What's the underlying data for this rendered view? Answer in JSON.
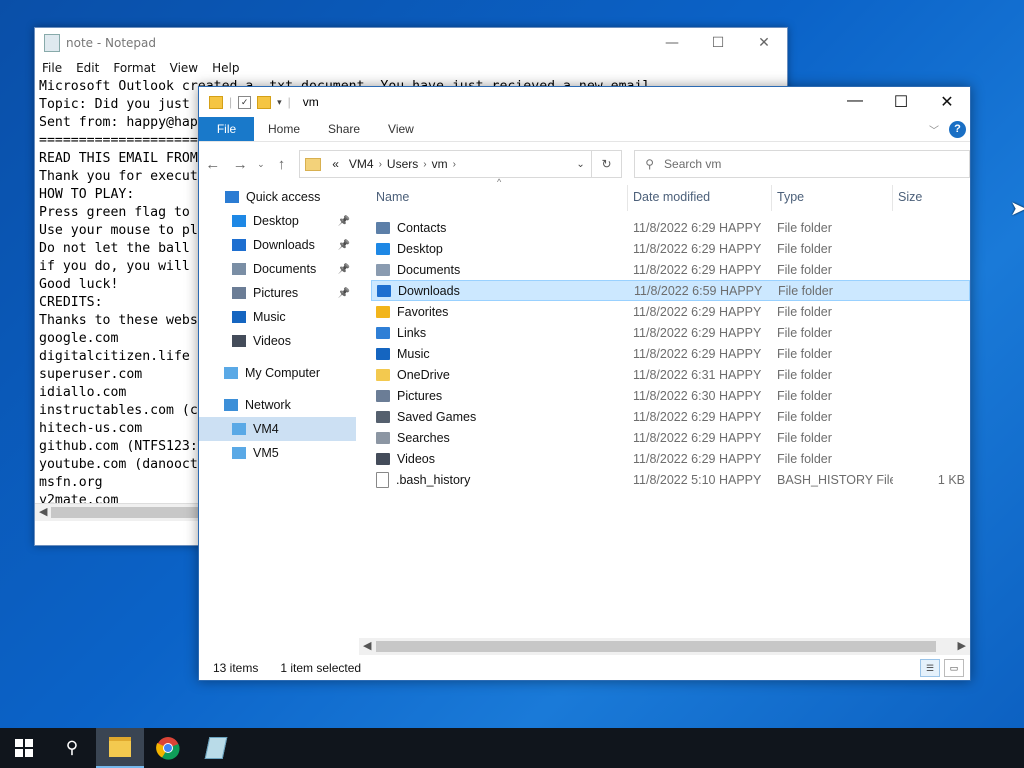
{
  "notepad": {
    "title": "note - Notepad",
    "menu": [
      "File",
      "Edit",
      "Format",
      "View",
      "Help"
    ],
    "lines": [
      "Microsoft Outlook created a .txt document. You have just recieved a new email",
      "Topic: Did you just",
      "Sent from: happy@hap",
      "================================",
      "READ THIS EMAIL FROM",
      "Thank you for execut",
      "HOW TO PLAY:",
      "Press green flag to",
      "Use your mouse to pl",
      "Do not let the ball",
      "if you do, you will",
      "Good luck!",
      "CREDITS:",
      "Thanks to these webs",
      "google.com",
      "digitalcitizen.life",
      "superuser.com",
      "idiallo.com",
      "instructables.com (c",
      "hitech-us.com",
      "github.com (NTFS123:",
      "youtube.com (danooct",
      "msfn.org",
      "y2mate.com"
    ]
  },
  "explorer": {
    "title": "vm",
    "ribbon_tabs": [
      "File",
      "Home",
      "Share",
      "View"
    ],
    "address": [
      "VM4",
      "Users",
      "vm"
    ],
    "address_prefix": "«",
    "search_placeholder": "Search vm",
    "nav": {
      "quick_access": "Quick access",
      "quick_items": [
        {
          "label": "Desktop",
          "icon": "desktop-icon",
          "color": "#1e88e5"
        },
        {
          "label": "Downloads",
          "icon": "download-icon",
          "color": "#1e6fd0"
        },
        {
          "label": "Documents",
          "icon": "documents-icon",
          "color": "#7a8ea5"
        },
        {
          "label": "Pictures",
          "icon": "pictures-icon",
          "color": "#6b7d96"
        },
        {
          "label": "Music",
          "icon": "music-icon",
          "color": "#1565c0"
        },
        {
          "label": "Videos",
          "icon": "videos-icon",
          "color": "#444c5a"
        }
      ],
      "my_computer": "My Computer",
      "network": "Network",
      "network_items": [
        "VM4",
        "VM5"
      ]
    },
    "columns": [
      "Name",
      "Date modified",
      "Type",
      "Size"
    ],
    "files": [
      {
        "name": "Contacts",
        "date": "11/8/2022 6:29 HAPPY",
        "type": "File folder",
        "size": "",
        "icon": "contacts-icon",
        "color": "#5c7fa8"
      },
      {
        "name": "Desktop",
        "date": "11/8/2022 6:29 HAPPY",
        "type": "File folder",
        "size": "",
        "icon": "desktop-icon",
        "color": "#1e88e5"
      },
      {
        "name": "Documents",
        "date": "11/8/2022 6:29 HAPPY",
        "type": "File folder",
        "size": "",
        "icon": "documents-icon",
        "color": "#8a9bb0"
      },
      {
        "name": "Downloads",
        "date": "11/8/2022 6:59 HAPPY",
        "type": "File folder",
        "size": "",
        "icon": "download-icon",
        "color": "#1e6fd0"
      },
      {
        "name": "Favorites",
        "date": "11/8/2022 6:29 HAPPY",
        "type": "File folder",
        "size": "",
        "icon": "star-icon",
        "color": "#f2b51b"
      },
      {
        "name": "Links",
        "date": "11/8/2022 6:29 HAPPY",
        "type": "File folder",
        "size": "",
        "icon": "links-icon",
        "color": "#2f7fd6"
      },
      {
        "name": "Music",
        "date": "11/8/2022 6:29 HAPPY",
        "type": "File folder",
        "size": "",
        "icon": "music-icon",
        "color": "#1565c0"
      },
      {
        "name": "OneDrive",
        "date": "11/8/2022 6:31 HAPPY",
        "type": "File folder",
        "size": "",
        "icon": "folder-icon",
        "color": "#f3c94f"
      },
      {
        "name": "Pictures",
        "date": "11/8/2022 6:30 HAPPY",
        "type": "File folder",
        "size": "",
        "icon": "pictures-icon",
        "color": "#6b7d96"
      },
      {
        "name": "Saved Games",
        "date": "11/8/2022 6:29 HAPPY",
        "type": "File folder",
        "size": "",
        "icon": "saved-games-icon",
        "color": "#55606e"
      },
      {
        "name": "Searches",
        "date": "11/8/2022 6:29 HAPPY",
        "type": "File folder",
        "size": "",
        "icon": "search-icon",
        "color": "#8c96a3"
      },
      {
        "name": "Videos",
        "date": "11/8/2022 6:29 HAPPY",
        "type": "File folder",
        "size": "",
        "icon": "videos-icon",
        "color": "#444c5a"
      },
      {
        "name": ".bash_history",
        "date": "11/8/2022 5:10 HAPPY",
        "type": "BASH_HISTORY File",
        "size": "1 KB",
        "icon": "file-icon",
        "color": "#ffffff"
      }
    ],
    "selected_file": "Downloads",
    "status": {
      "items": "13 items",
      "selected": "1 item selected"
    }
  },
  "taskbar": {
    "items": [
      "start-button",
      "search-button",
      "file-explorer-app",
      "chrome-app",
      "notepad-app"
    ],
    "active": "file-explorer-app"
  }
}
